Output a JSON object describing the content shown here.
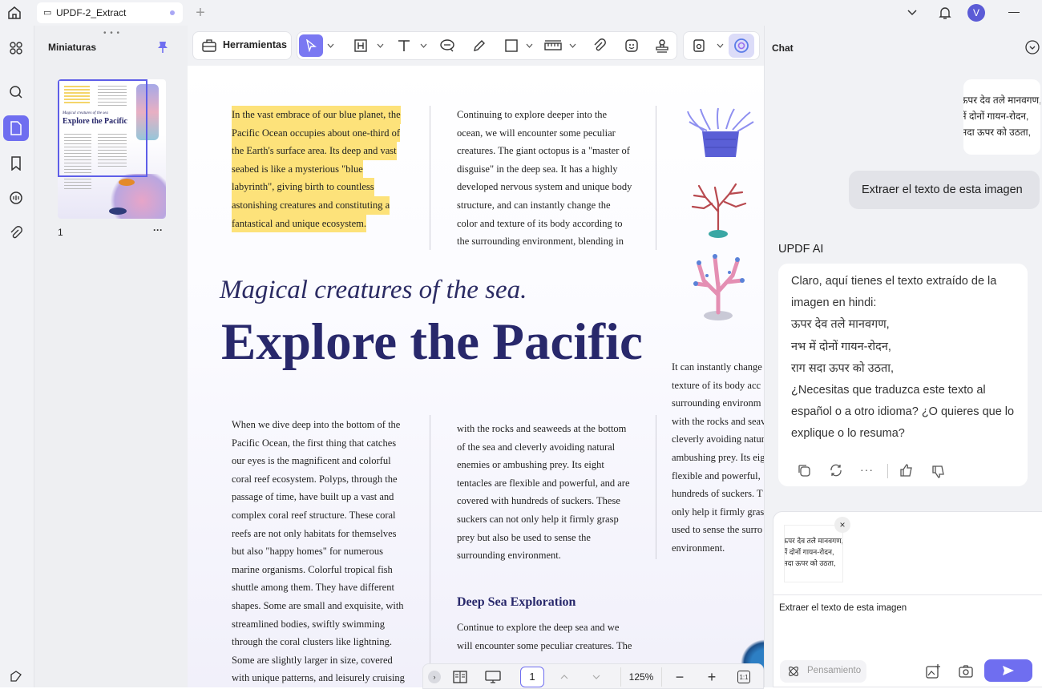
{
  "tab": {
    "title": "UPDF-2_Extract"
  },
  "user": {
    "initial": "V"
  },
  "sidebar": {
    "title": "Miniaturas",
    "page_label": "1",
    "more": "···"
  },
  "toolbar": {
    "tools_label": "Herramientas"
  },
  "document": {
    "col1_intro": [
      "In the vast embrace of our blue planet, the",
      "Pacific Ocean occupies about one-third of",
      "the Earth's surface area. Its deep and vast",
      "seabed is like a mysterious \"blue",
      "labyrinth\", giving birth to countless",
      "astonishing creatures and constituting a",
      "fantastical and unique ecosystem."
    ],
    "col2_intro": [
      "Continuing to explore deeper into the",
      "ocean, we will encounter some peculiar",
      "creatures. The giant octopus is a \"master of",
      "disguise\" in the deep sea. It has a highly",
      "developed nervous system and unique body",
      "structure, and can instantly change the",
      "color and texture of its body according to",
      "the surrounding environment, blending in"
    ],
    "italic_title": "Magical creatures of the sea.",
    "big_title": "Explore the Pacific",
    "col1_body": [
      "When we dive deep into the bottom of the",
      "Pacific Ocean, the first thing that catches",
      "our eyes is the magnificent and colorful",
      "coral reef ecosystem. Polyps, through the",
      "passage of time, have built up a vast and",
      "complex coral reef structure. These coral",
      "reefs are not only habitats for themselves",
      "but also \"happy homes\" for numerous",
      "marine organisms. Colorful tropical fish",
      "shuttle among them. They have different",
      "shapes. Some are small and exquisite, with",
      "streamlined bodies, swiftly swimming",
      "through the coral clusters like lightning.",
      "Some are slightly larger in size, covered",
      "with unique patterns, and leisurely cruising"
    ],
    "col2_body": [
      "with the rocks and seaweeds at the bottom",
      "of the sea and cleverly avoiding natural",
      "enemies or ambushing prey. Its eight",
      "tentacles are flexible and powerful, and are",
      "covered with hundreds of suckers. These",
      "suckers can not only help it firmly grasp",
      "prey but also be used to sense the",
      "surrounding environment."
    ],
    "col3_body": [
      "It can instantly change",
      "texture of its body acc",
      "surrounding environm",
      "with the rocks and seav",
      "cleverly avoiding natur",
      "ambushing prey. Its eig",
      "flexible and powerful,",
      "hundreds of suckers. T",
      "only help it firmly gras",
      "used to sense the surro",
      "environment."
    ],
    "deep_heading": "Deep Sea Exploration",
    "deep_body": [
      "Continue to explore the deep sea and we",
      "will encounter some peculiar creatures. The"
    ]
  },
  "pagebar": {
    "page": "1",
    "zoom": "125%"
  },
  "chat": {
    "title": "Chat",
    "image_lines": [
      "ऊपर देव तले मानवगण,",
      "नभ में दोनों गायन-रोदन,",
      "राग सदा ऊपर को उठता,"
    ],
    "user_message": "Extraer el texto de esta imagen",
    "ai_label": "UPDF AI",
    "ai_lines": [
      "Claro, aquí tienes el texto extraído de la",
      "imagen en hindi:",
      "ऊपर देव तले मानवगण,",
      "नभ में दोनों गायन-रोदन,",
      "राग सदा ऊपर को उठता,",
      "¿Necesitas que traduzca este texto al",
      "español o a otro idioma? ¿O quieres que lo",
      "explique o lo resuma?"
    ],
    "composer_text": "Extraer el texto de esta imagen",
    "thinking_label": "Pensamiento",
    "accent": "#6f6ef0"
  }
}
